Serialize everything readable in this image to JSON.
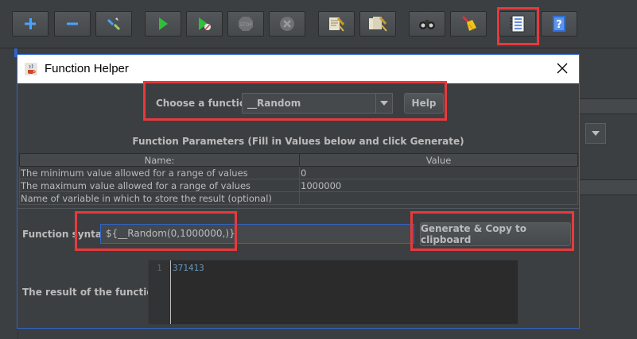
{
  "toolbar": {
    "buttons": [
      {
        "icon": "plus-icon"
      },
      {
        "icon": "minus-icon"
      },
      {
        "icon": "toggle-wand-icon"
      },
      {
        "icon": "start-icon"
      },
      {
        "icon": "start-no-pauses-icon"
      },
      {
        "icon": "stop-icon"
      },
      {
        "icon": "shutdown-icon"
      },
      {
        "icon": "clear-icon"
      },
      {
        "icon": "clear-all-icon"
      },
      {
        "icon": "search-binoculars-icon"
      },
      {
        "icon": "reset-search-broom-icon"
      },
      {
        "icon": "function-helper-icon"
      },
      {
        "icon": "help-icon"
      }
    ]
  },
  "dialog": {
    "title": "Function Helper",
    "choose_label": "Choose a function",
    "selected_function": "__Random",
    "help_label": "Help",
    "params_title": "Function Parameters (Fill in Values below and click Generate)",
    "table": {
      "headers": [
        "Name:",
        "Value"
      ],
      "rows": [
        [
          "The minimum value allowed for a range of values",
          "0"
        ],
        [
          "The maximum value allowed for a range of values",
          "1000000"
        ],
        [
          "Name of variable in which to store the result (optional)",
          ""
        ]
      ]
    },
    "syntax_label": "Function syntax:",
    "syntax_value": "${__Random(0,1000000,)}",
    "generate_label": "Generate & Copy to clipboard",
    "result_label": "The result of the function is",
    "result_line_number": "1",
    "result_value": "371413"
  },
  "colors": {
    "background": "#3c3f41",
    "highlight": "#e8393c",
    "focus": "#2f65ca"
  }
}
